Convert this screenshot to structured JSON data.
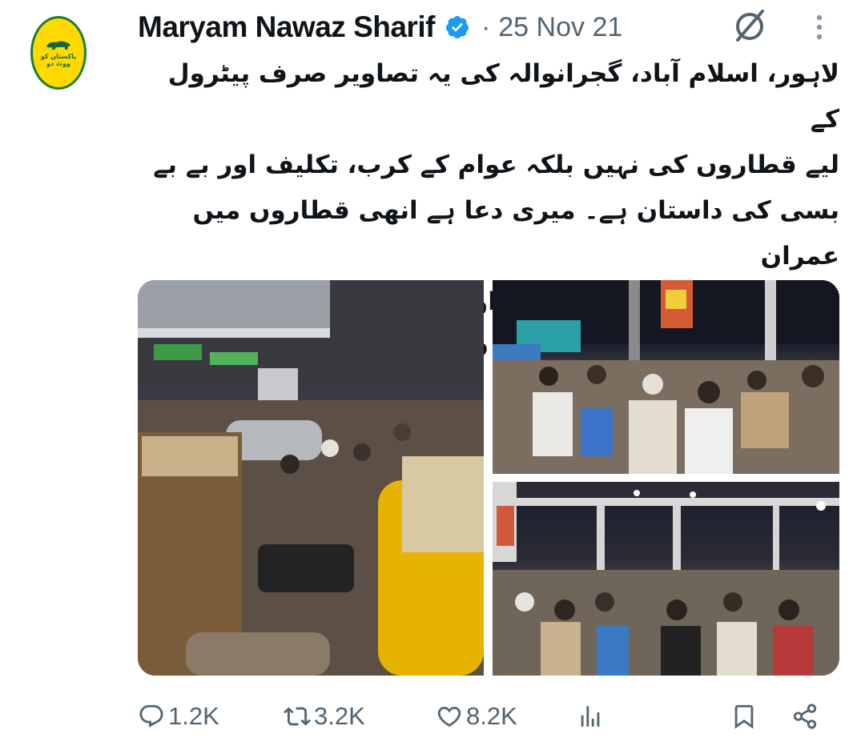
{
  "author": {
    "name": "Maryam Nawaz Sharif",
    "verified": true,
    "avatar_icon": "pmln-party-logo",
    "avatar_text": "پاکستان کو ووٹ دو"
  },
  "meta": {
    "separator": "·",
    "date": "25 Nov 21"
  },
  "tweet": {
    "lines": [
      "لاہور، اسلام آباد، گجرانوالہ کی یہ تصاویر صرف پیٹرول کے",
      "لیے قطاروں کی نہیں بلکہ عوام کے کرب، تکلیف اور بے بے",
      "بسی کی داستان ہے۔ میری دعا ہے انھی قطاروں میں عمران",
      "خان، اسکو مسلط کرنے والے اور وزرا بھی کھڑے ہوں تاکہ",
      "انھیں پتہ چلے کہ عوام پر کیا قیامت ٹوٹی ہے۔"
    ]
  },
  "media": {
    "images": [
      {
        "name": "petrol-station-queue-motorbikes"
      },
      {
        "name": "crowd-at-petrol-pump-night"
      },
      {
        "name": "crowd-under-canopy-night"
      }
    ]
  },
  "actions": {
    "reply_count": "1.2K",
    "retweet_count": "3.2K",
    "like_count": "8.2K"
  },
  "colors": {
    "verified": "#1d9bf0",
    "muted": "#536471",
    "text": "#0f1419"
  }
}
